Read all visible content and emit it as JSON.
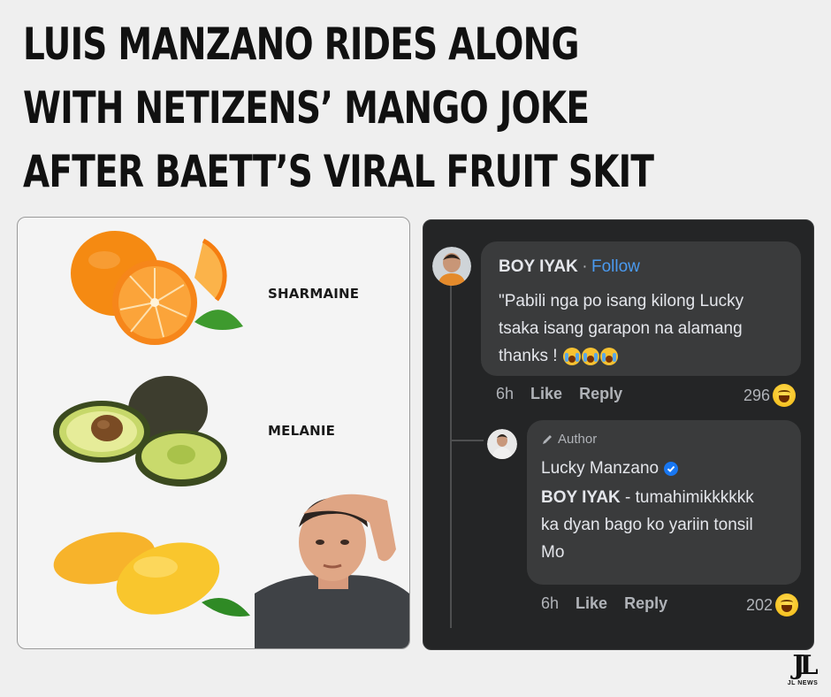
{
  "headline": {
    "line1": "LUIS MANZANO RIDES ALONG",
    "line2": "WITH NETIZENS’ MANGO JOKE",
    "line3": "AFTER BAETT’S VIRAL FRUIT SKIT"
  },
  "fruit_panel": {
    "labels": [
      "SHARMAINE",
      "MELANIE"
    ]
  },
  "comments": {
    "main": {
      "author": "BOY IYAK",
      "separator": "·",
      "follow_label": "Follow",
      "text_line1": "\"Pabili nga po isang kilong Lucky",
      "text_line2": "tsaka isang garapon na alamang",
      "text_line3": "thanks !",
      "time": "6h",
      "like_label": "Like",
      "reply_label": "Reply",
      "reaction_count": "296",
      "reaction_icon": "haha-emoji-icon"
    },
    "reply": {
      "badge": "Author",
      "author": "Lucky Manzano",
      "verified_icon": "verified-badge-icon",
      "mention": "BOY IYAK",
      "text_line1": " - tumahimikkkkkk",
      "text_line2": "ka dyan bago ko yariin tonsil",
      "text_line3": "Mo",
      "time": "6h",
      "like_label": "Like",
      "reply_label": "Reply",
      "reaction_count": "202",
      "reaction_icon": "haha-emoji-icon"
    }
  },
  "logo": {
    "text": "JL NEWS"
  },
  "colors": {
    "background": "#efefef",
    "comment_panel": "#242526",
    "bubble": "#3a3b3c",
    "follow_link": "#4a9af0",
    "verified": "#1877f2"
  }
}
